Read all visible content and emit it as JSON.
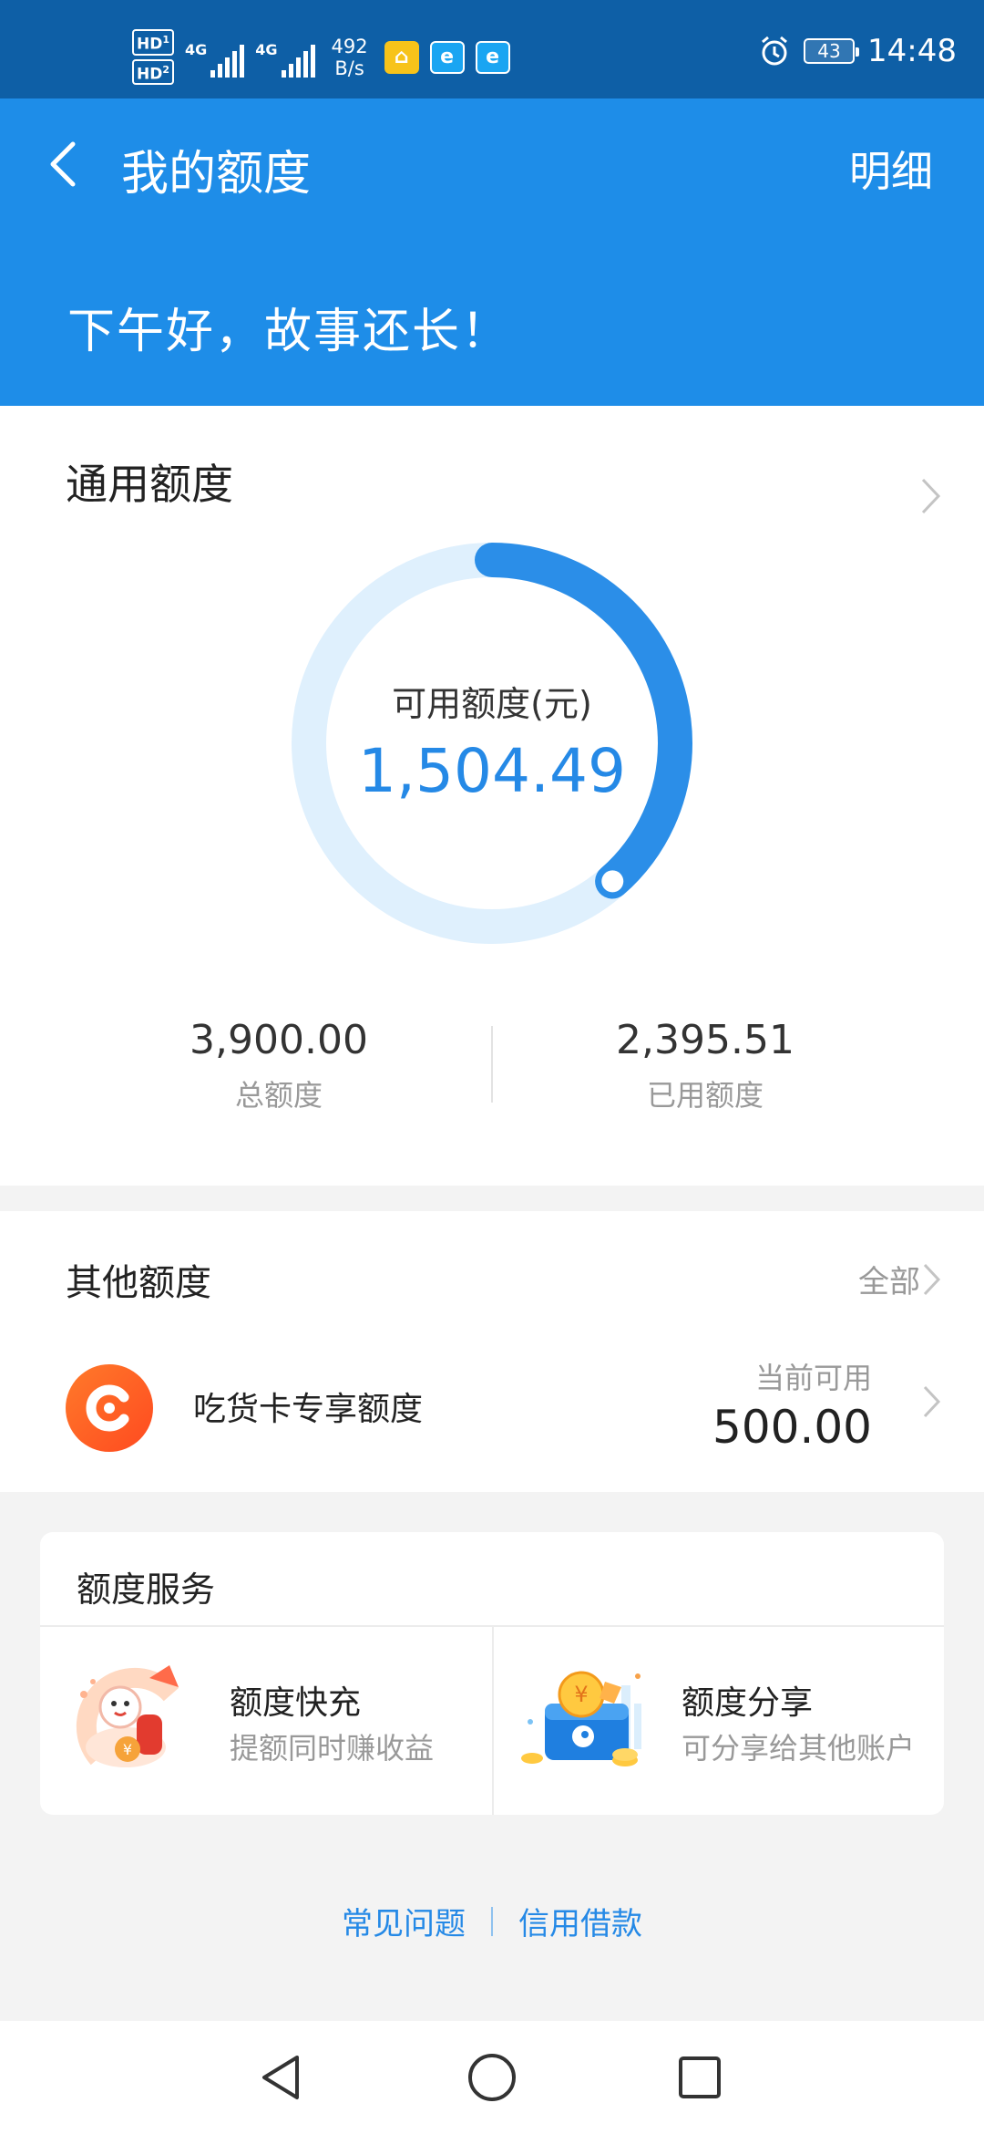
{
  "status_bar": {
    "hd1": "HD",
    "hd2": "HD",
    "sim1_sub": "1",
    "sim2_sub": "2",
    "signal1_label": "4G",
    "signal2_label": "4G",
    "net_speed_value": "492",
    "net_speed_unit": "B/s",
    "battery": "43",
    "time": "14:48"
  },
  "header": {
    "title": "我的额度",
    "detail_link": "明细",
    "greeting": "下午好，故事还长！"
  },
  "general_quota": {
    "title": "通用额度",
    "ring_label": "可用额度(元)",
    "available": "1,504.49",
    "available_fraction": 0.3857,
    "total_value": "3,900.00",
    "total_label": "总额度",
    "used_value": "2,395.51",
    "used_label": "已用额度",
    "ring_color": "#2b8ee8",
    "ring_track_color": "#dff0fd"
  },
  "other_quota": {
    "title": "其他额度",
    "all_link": "全部",
    "item": {
      "label": "吃货卡专享额度",
      "current_label": "当前可用",
      "current_value": "500.00",
      "icon": "snack-card-icon"
    }
  },
  "services": {
    "title": "额度服务",
    "items": [
      {
        "title": "额度快充",
        "subtitle": "提额同时赚收益",
        "icon": "quick-charge-icon"
      },
      {
        "title": "额度分享",
        "subtitle": "可分享给其他账户",
        "icon": "wallet-share-icon"
      }
    ]
  },
  "footer": {
    "faq": "常见问题",
    "credit_loan": "信用借款"
  },
  "colors": {
    "status_bar": "#0e5fa6",
    "header": "#1e8de8",
    "accent": "#2589e6"
  }
}
